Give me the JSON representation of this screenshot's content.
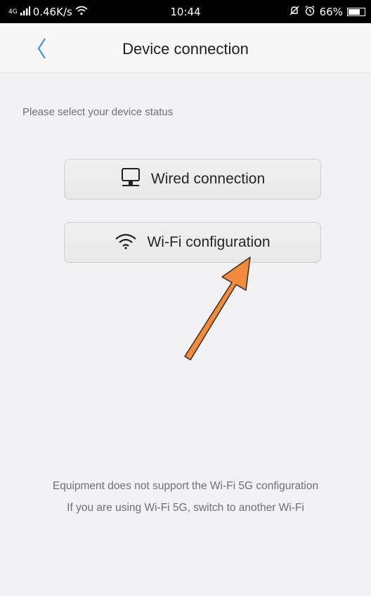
{
  "status_bar": {
    "signal_tag": "4G",
    "network_speed": "0.46K/s",
    "time": "10:44",
    "battery_percent": "66%",
    "battery_level": 0.66
  },
  "header": {
    "title": "Device connection"
  },
  "main": {
    "instruction": "Please select your device status",
    "options": [
      {
        "label": "Wired connection",
        "icon": "monitor-icon"
      },
      {
        "label": "Wi-Fi configuration",
        "icon": "wifi-icon"
      }
    ],
    "notes": [
      "Equipment does not support the Wi-Fi 5G configuration",
      "If you are using Wi-Fi 5G, switch to another Wi-Fi"
    ]
  },
  "annotation": {
    "arrow_color": "#f08a3c"
  }
}
